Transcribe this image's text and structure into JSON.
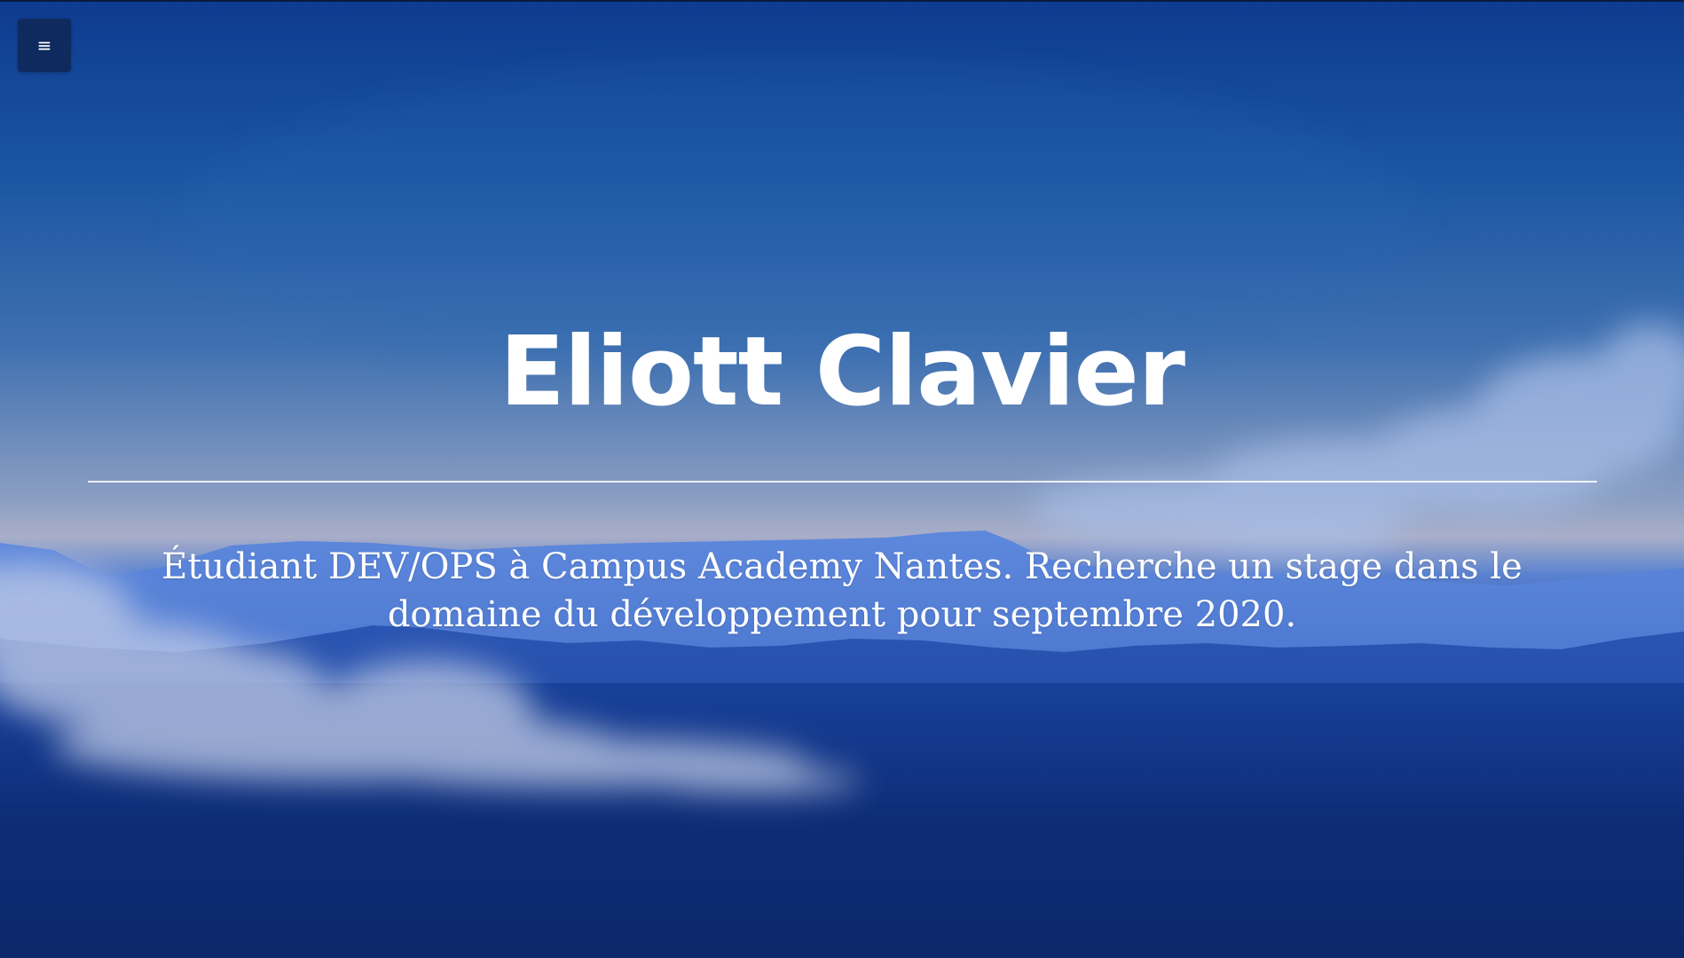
{
  "nav": {
    "menu_icon": "hamburger-menu-icon",
    "menu_glyph": "≡"
  },
  "hero": {
    "title": "Eliott Clavier",
    "subtitle": "Étudiant DEV/OPS à Campus Academy Nantes. Recherche un stage dans le domaine du développement pour septembre 2020."
  },
  "colors": {
    "sky_top": "#0e3b8f",
    "sky_mid": "#8a9ec2",
    "mountains": "#2f5cc0",
    "menu_button": "#0f2a5e",
    "text": "#ffffff"
  }
}
